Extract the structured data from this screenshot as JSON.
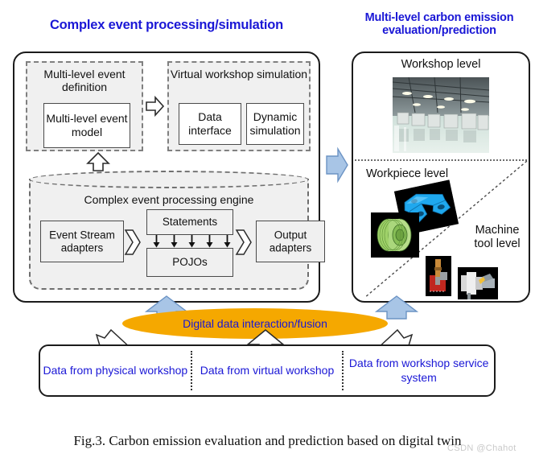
{
  "titles": {
    "left": "Complex event processing/simulation",
    "right": "Multi-level carbon emission evaluation/prediction"
  },
  "left_panel": {
    "event_definition": {
      "label": "Multi-level event definition",
      "inner_box": "Multi-level event model"
    },
    "virtual_workshop": {
      "label": "Virtual workshop simulation",
      "data_interface": "Data interface",
      "dynamic_simulation": "Dynamic simulation"
    },
    "cep_engine": {
      "title": "Complex event processing engine",
      "event_stream_adapters": "Event Stream adapters",
      "statements": "Statements",
      "pojos": "POJOs",
      "output_adapters": "Output adapters",
      "tick_arrow_count": 5
    }
  },
  "right_panel": {
    "workshop_level": "Workshop level",
    "workpiece_level": "Workpiece level",
    "machine_tool_level": "Machine tool level",
    "images": {
      "workshop_photo": "factory-workshop-photo",
      "bracket": "blue-cad-bracket-image",
      "hub": "green-wheel-hub-image",
      "milling": "milling-simulation-image",
      "turning": "turning-simulation-image"
    }
  },
  "fusion": {
    "label": "Digital data interaction/fusion",
    "color": "#f5a800",
    "text_color": "#1a17d6"
  },
  "data_sources": [
    "Data from physical workshop",
    "Data from virtual workshop",
    "Data from workshop service system"
  ],
  "caption": "Fig.3. Carbon emission evaluation and prediction based on digital twin",
  "watermark": "CSDN @Chahot",
  "colors": {
    "title_blue": "#1a17d6",
    "panel_border": "#1b1b1b",
    "dashed_grey": "#808080",
    "block_fill": "#f0f0f0",
    "blue_arrow": "#a8c5e6",
    "blue_arrow_border": "#6b93c4",
    "orange": "#f5a800"
  }
}
